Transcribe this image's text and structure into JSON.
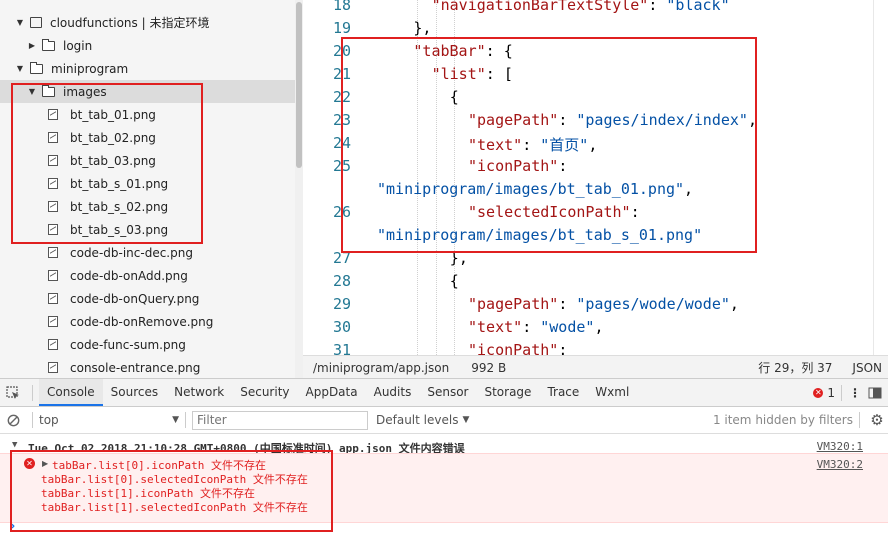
{
  "tree": {
    "items": [
      {
        "label": "cloudfunctions | 未指定环境",
        "kind": "cloud",
        "arrow": "▼",
        "level": 0
      },
      {
        "label": "login",
        "kind": "folder",
        "arrow": "▶",
        "level": 1
      },
      {
        "label": "miniprogram",
        "kind": "folder",
        "arrow": "▼",
        "level": 0
      },
      {
        "label": "images",
        "kind": "folder",
        "arrow": "▼",
        "level": 1
      },
      {
        "label": "bt_tab_01.png",
        "kind": "file",
        "level": 2
      },
      {
        "label": "bt_tab_02.png",
        "kind": "file",
        "level": 2
      },
      {
        "label": "bt_tab_03.png",
        "kind": "file",
        "level": 2
      },
      {
        "label": "bt_tab_s_01.png",
        "kind": "file",
        "level": 2
      },
      {
        "label": "bt_tab_s_02.png",
        "kind": "file",
        "level": 2
      },
      {
        "label": "bt_tab_s_03.png",
        "kind": "file",
        "level": 2
      },
      {
        "label": "code-db-inc-dec.png",
        "kind": "file",
        "level": 2
      },
      {
        "label": "code-db-onAdd.png",
        "kind": "file",
        "level": 2
      },
      {
        "label": "code-db-onQuery.png",
        "kind": "file",
        "level": 2
      },
      {
        "label": "code-db-onRemove.png",
        "kind": "file",
        "level": 2
      },
      {
        "label": "code-func-sum.png",
        "kind": "file",
        "level": 2
      },
      {
        "label": "console-entrance.png",
        "kind": "file",
        "level": 2
      }
    ]
  },
  "editor": {
    "lines": [
      {
        "num": "18",
        "indent": 6,
        "parts": [
          [
            "k",
            "\"navigationBarTextStyle\""
          ],
          [
            "p",
            ": "
          ],
          [
            "s",
            "\"black\""
          ]
        ]
      },
      {
        "num": "19",
        "indent": 4,
        "parts": [
          [
            "p",
            "},"
          ]
        ]
      },
      {
        "num": "20",
        "indent": 4,
        "parts": [
          [
            "k",
            "\"tabBar\""
          ],
          [
            "p",
            ": {"
          ]
        ]
      },
      {
        "num": "21",
        "indent": 6,
        "parts": [
          [
            "k",
            "\"list\""
          ],
          [
            "p",
            ": ["
          ]
        ]
      },
      {
        "num": "22",
        "indent": 8,
        "parts": [
          [
            "p",
            "{"
          ]
        ]
      },
      {
        "num": "23",
        "indent": 10,
        "parts": [
          [
            "k",
            "\"pagePath\""
          ],
          [
            "p",
            ": "
          ],
          [
            "s",
            "\"pages/index/index\""
          ],
          [
            "p",
            ","
          ]
        ]
      },
      {
        "num": "24",
        "indent": 10,
        "parts": [
          [
            "k",
            "\"text\""
          ],
          [
            "p",
            ": "
          ],
          [
            "s",
            "\"首页\""
          ],
          [
            "p",
            ","
          ]
        ]
      },
      {
        "num": "25",
        "indent": 10,
        "parts": [
          [
            "k",
            "\"iconPath\""
          ],
          [
            "p",
            ":"
          ]
        ]
      },
      {
        "num": "",
        "indent": 0,
        "parts": [
          [
            "s",
            "\"miniprogram/images/bt_tab_01.png\""
          ],
          [
            "p",
            ","
          ]
        ]
      },
      {
        "num": "26",
        "indent": 10,
        "parts": [
          [
            "k",
            "\"selectedIconPath\""
          ],
          [
            "p",
            ":"
          ]
        ]
      },
      {
        "num": "",
        "indent": 0,
        "parts": [
          [
            "s",
            "\"miniprogram/images/bt_tab_s_01.png\""
          ]
        ]
      },
      {
        "num": "27",
        "indent": 8,
        "parts": [
          [
            "p",
            "},"
          ]
        ]
      },
      {
        "num": "28",
        "indent": 8,
        "parts": [
          [
            "p",
            "{"
          ]
        ]
      },
      {
        "num": "29",
        "indent": 10,
        "parts": [
          [
            "k",
            "\"pagePath\""
          ],
          [
            "p",
            ": "
          ],
          [
            "s",
            "\"pages/wode/wode\""
          ],
          [
            "p",
            ","
          ]
        ]
      },
      {
        "num": "30",
        "indent": 10,
        "parts": [
          [
            "k",
            "\"text\""
          ],
          [
            "p",
            ": "
          ],
          [
            "s",
            "\"wode\""
          ],
          [
            "p",
            ","
          ]
        ]
      },
      {
        "num": "31",
        "indent": 10,
        "parts": [
          [
            "k",
            "\"iconPath\""
          ],
          [
            "p",
            ":"
          ]
        ]
      }
    ]
  },
  "status": {
    "path": "/miniprogram/app.json",
    "size": "992 B",
    "position": "行 29，列 37",
    "lang": "JSON"
  },
  "devtools": {
    "tabs": [
      "Console",
      "Sources",
      "Network",
      "Security",
      "AppData",
      "Audits",
      "Sensor",
      "Storage",
      "Trace",
      "Wxml"
    ],
    "error_count": "1",
    "context": "top",
    "filter_placeholder": "Filter",
    "levels": "Default levels",
    "hidden": "1 item hidden by filters",
    "group_header": "Tue Oct 02 2018 21:10:28 GMT+0800 (中国标准时间)  app.json 文件内容错误",
    "group_link": "VM320:1",
    "error_link": "VM320:2",
    "error_lines": [
      "tabBar.list[0].iconPath 文件不存在",
      "tabBar.list[0].selectedIconPath 文件不存在",
      "tabBar.list[1].iconPath 文件不存在",
      "tabBar.list[1].selectedIconPath 文件不存在"
    ],
    "prompt": "›"
  },
  "colors": {
    "accent": "#1a73e8",
    "error": "#e02020",
    "json_key": "#a31515",
    "json_string": "#0451a5",
    "line_number": "#237893"
  }
}
